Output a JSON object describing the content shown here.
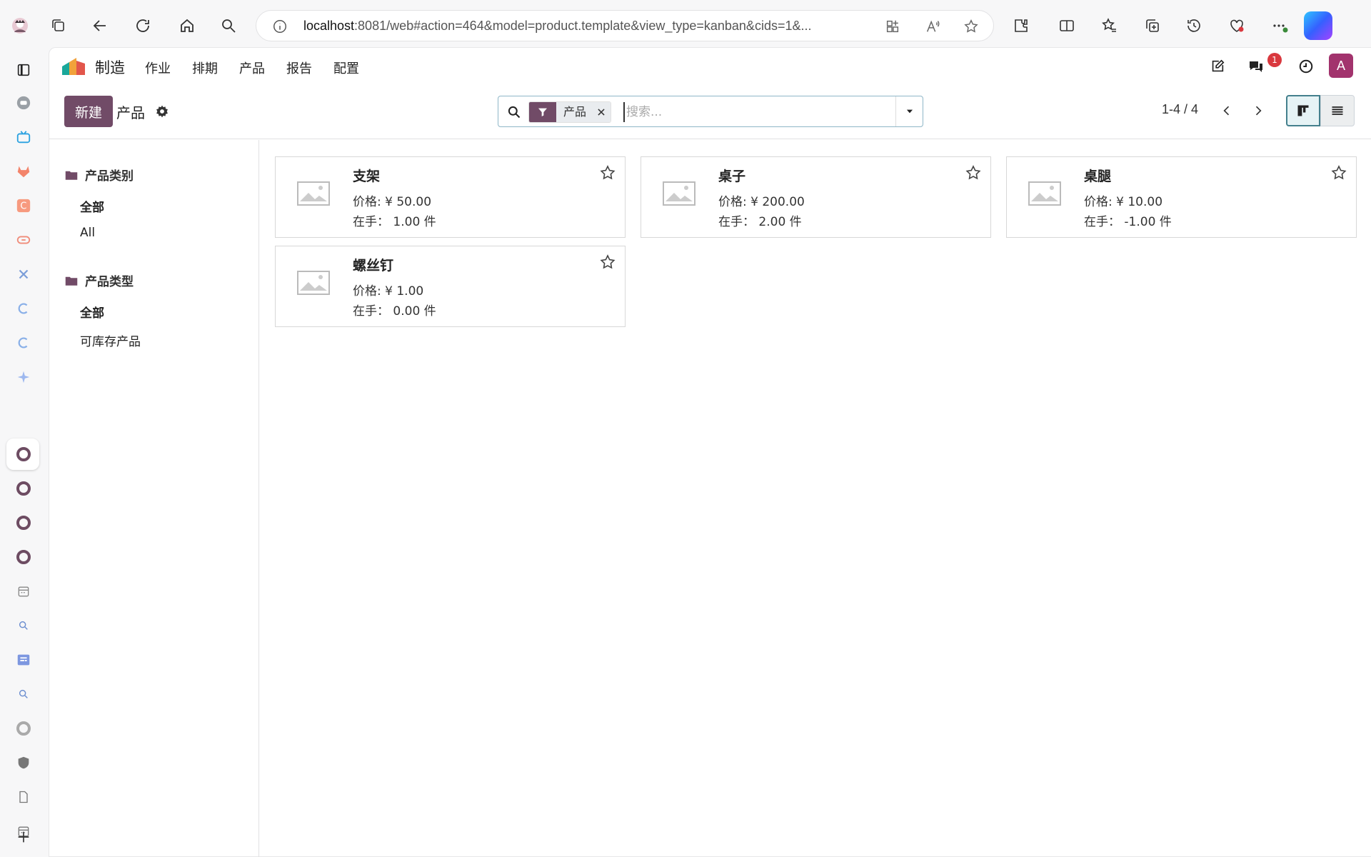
{
  "browser": {
    "url_host": "localhost",
    "url_rest": ":8081/web#action=464&model=product.template&view_type=kanban&cids=1&..."
  },
  "app": {
    "brand": "制造",
    "menus": [
      "作业",
      "排期",
      "产品",
      "报告",
      "配置"
    ],
    "notification_count": "1",
    "avatar_letter": "A",
    "accent": "#714b67"
  },
  "control": {
    "new_label": "新建",
    "breadcrumb": "产品",
    "facet_label": "产品",
    "search_placeholder": "搜索...",
    "pager": "1-4 / 4"
  },
  "sidebar": {
    "sections": [
      {
        "title": "产品类别",
        "items": [
          "全部",
          "All"
        ]
      },
      {
        "title": "产品类型",
        "items": [
          "全部",
          "可库存产品"
        ]
      }
    ]
  },
  "products": [
    {
      "name": "支架",
      "price": "价格: ¥ 50.00",
      "on_hand": "在手：  1.00 件"
    },
    {
      "name": "桌子",
      "price": "价格: ¥ 200.00",
      "on_hand": "在手：  2.00 件"
    },
    {
      "name": "桌腿",
      "price": "价格: ¥ 10.00",
      "on_hand": "在手：  -1.00 件"
    },
    {
      "name": "螺丝钉",
      "price": "价格: ¥ 1.00",
      "on_hand": "在手：  0.00 件"
    }
  ]
}
